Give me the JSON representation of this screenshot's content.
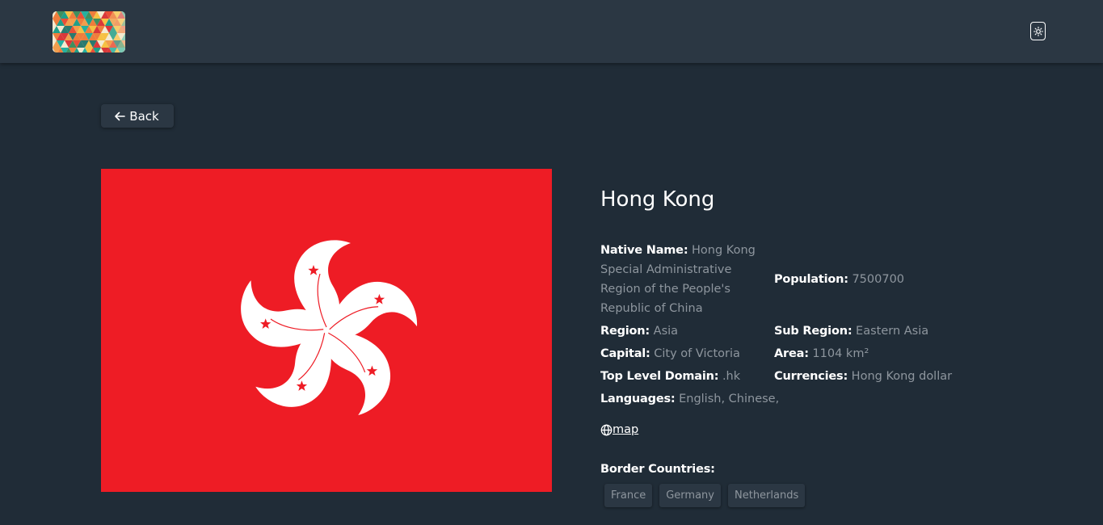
{
  "header": {
    "logo_icon": "triangle-mosaic-logo",
    "theme_toggle_icon": "sun-icon"
  },
  "back_button": {
    "icon": "arrow-left-icon",
    "label": "Back"
  },
  "country": {
    "name": "Hong Kong",
    "flag_icon": "hong-kong-flag",
    "flag_color": "#ee1c25",
    "fields": {
      "native_name": {
        "label": "Native Name:",
        "value": "Hong Kong Special Administrative Region of the People's Republic of China"
      },
      "population": {
        "label": "Population:",
        "value": "7500700"
      },
      "region": {
        "label": "Region:",
        "value": "Asia"
      },
      "sub_region": {
        "label": "Sub Region:",
        "value": "Eastern Asia"
      },
      "capital": {
        "label": "Capital:",
        "value": "City of Victoria"
      },
      "area": {
        "label": "Area:",
        "value": "1104 km²"
      },
      "tld": {
        "label": "Top Level Domain:",
        "value": ".hk"
      },
      "currencies": {
        "label": "Currencies:",
        "value": "Hong Kong dollar"
      },
      "languages": {
        "label": "Languages:",
        "value": "English, Chinese,"
      }
    },
    "map_link": {
      "icon": "globe-icon",
      "label": "map"
    },
    "border_countries": {
      "title": "Border Countries:",
      "items": [
        "France",
        "Germany",
        "Netherlands"
      ]
    }
  },
  "colors": {
    "background": "#202c37",
    "elements": "#2b3743",
    "text": "#ffffff",
    "muted_text": "#8e969e"
  }
}
